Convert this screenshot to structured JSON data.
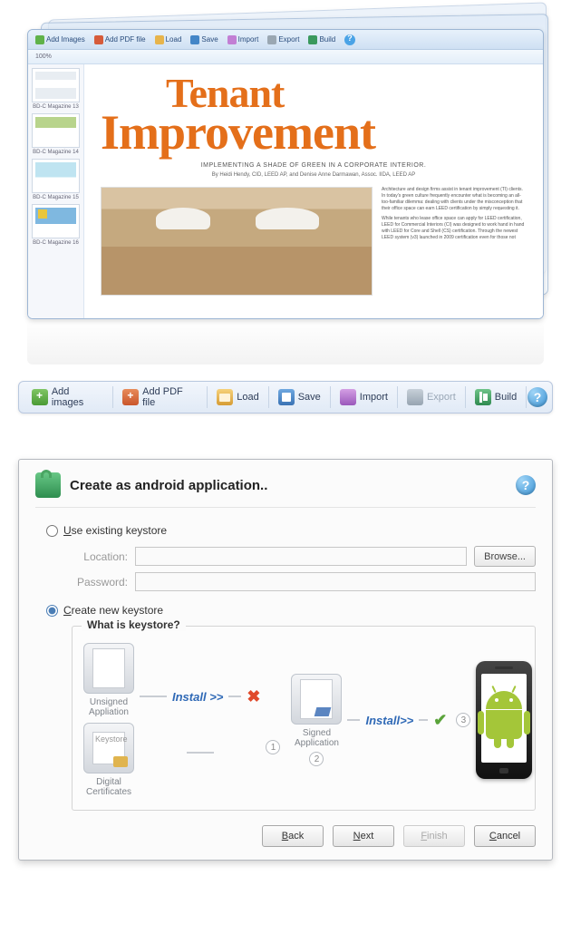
{
  "app": {
    "toolbar": {
      "add_images": "Add Images",
      "add_pdf": "Add PDF file",
      "load": "Load",
      "save": "Save",
      "import": "Import",
      "export": "Export",
      "build": "Build",
      "zoom": "100%"
    },
    "thumbs": [
      {
        "label": "BD-C Magazine 13"
      },
      {
        "label": "BD-C Magazine 14"
      },
      {
        "label": "BD-C Magazine 15"
      },
      {
        "label": "BD-C Magazine 16"
      }
    ],
    "article": {
      "title_line1": "Tenant",
      "title_line2": "Improvement",
      "subtitle": "IMPLEMENTING A SHADE OF GREEN IN A CORPORATE INTERIOR.",
      "byline": "By Heidi Hendy, CID, LEED AP, and Denise Anne Darmawan, Assoc. IIDA, LEED AP",
      "body_1": "Architecture and design firms assist in tenant improvement (TI) clients. In today's green culture frequently encounter what is becoming an all-too-familiar dilemma: dealing with clients under the misconception that their office space can earn LEED certification by simply requesting it.",
      "body_2": "While tenants who lease office space can apply for LEED certification, LEED for Commercial Interiors (CI) was designed to work hand in hand with LEED for Core and Shell (CS) certification. Through the newest LEED system (v3) launched in 2009 certification even for those not"
    }
  },
  "toolbar": {
    "add_images": "Add images",
    "add_pdf": "Add PDF file",
    "load": "Load",
    "save": "Save",
    "import": "Import",
    "export": "Export",
    "build": "Build",
    "help": "?"
  },
  "dialog": {
    "title": "Create as android application..",
    "use_existing": "Use existing keystore",
    "create_new": "Create new keystore",
    "location_label": "Location:",
    "password_label": "Password:",
    "browse": "Browse...",
    "location_value": "",
    "password_value": "",
    "keystore_title": "What is keystore?",
    "unsigned": "Unsigned Appliation",
    "certs": "Digital Certificates",
    "certs_tag": "Keystore",
    "signed": "Signed Application",
    "install": "Install",
    "install_suffix": ">>",
    "step1": "1",
    "step2": "2",
    "step3": "3",
    "buttons": {
      "back": "Back",
      "next": "Next",
      "finish": "Finish",
      "cancel": "Cancel"
    }
  }
}
